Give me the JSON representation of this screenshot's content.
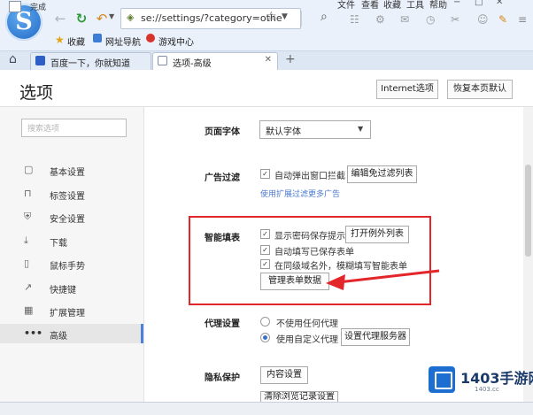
{
  "browser": {
    "logo_letter": "S",
    "address": "se://settings/?category=othe",
    "menu": [
      "文件",
      "查看",
      "收藏",
      "工具",
      "帮助"
    ],
    "favorites": [
      "收藏",
      "网址导航",
      "游戏中心"
    ],
    "tabs": [
      {
        "title": "百度一下，你就知道"
      },
      {
        "title": "选项-高级"
      }
    ],
    "new_tab": "+"
  },
  "header": {
    "title": "选项",
    "internet_options": "Internet选项",
    "restore_default": "恢复本页默认"
  },
  "sidebar": {
    "search_placeholder": "搜索选项",
    "items": [
      {
        "label": "基本设置",
        "icon": "settings-icon"
      },
      {
        "label": "标签设置",
        "icon": "tab-icon"
      },
      {
        "label": "安全设置",
        "icon": "shield-icon"
      },
      {
        "label": "下载",
        "icon": "download-icon"
      },
      {
        "label": "鼠标手势",
        "icon": "mouse-icon"
      },
      {
        "label": "快捷键",
        "icon": "shortcut-icon"
      },
      {
        "label": "扩展管理",
        "icon": "extension-icon"
      },
      {
        "label": "高级",
        "icon": "more-icon",
        "active": true
      }
    ]
  },
  "settings": {
    "page_font": {
      "label": "页面字体",
      "value": "默认字体"
    },
    "ad_filter": {
      "label": "广告过滤",
      "popup_block": "自动弹出窗口拦截",
      "edit_list": "编辑免过滤列表",
      "hint": "使用扩展过滤更多广告"
    },
    "autofill": {
      "label": "智能填表",
      "show_password_prompt": "显示密码保存提示",
      "exceptions": "打开例外列表",
      "auto_fill_saved": "自动填写已保存表单",
      "smart_fill_domains": "在同级域名外，模糊填写智能表单",
      "manage_forms": "管理表单数据"
    },
    "proxy": {
      "label": "代理设置",
      "no_proxy": "不使用任何代理",
      "custom_proxy": "使用自定义代理",
      "configure": "设置代理服务器"
    },
    "privacy": {
      "label": "隐私保护",
      "content_settings": "内容设置",
      "more": "清除浏览记录设置"
    }
  },
  "status": {
    "text": "完成"
  },
  "watermark": {
    "brand": "1403手游网",
    "url": "1403.cc"
  },
  "colors": {
    "highlight": "#e2262a",
    "accent": "#4a83d9"
  }
}
